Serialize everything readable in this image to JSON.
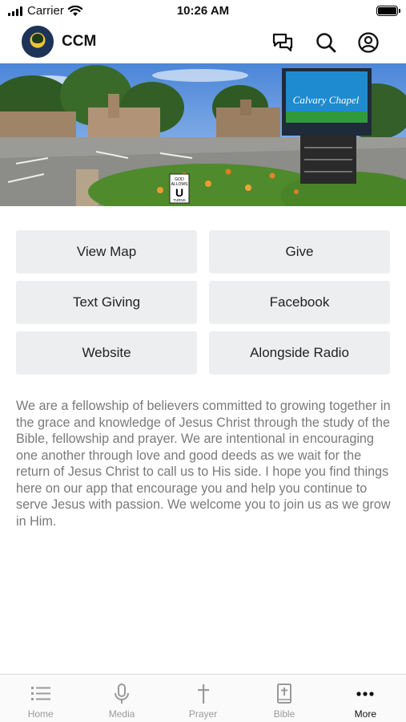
{
  "status_bar": {
    "carrier": "Carrier",
    "time": "10:26 AM"
  },
  "header": {
    "title": "CCM",
    "icons": [
      "chat-icon",
      "search-icon",
      "account-icon"
    ]
  },
  "banner": {
    "sign_title": "Calvary Chapel",
    "sign_small_1": "GOD",
    "sign_small_2": "ALLOWS",
    "sign_small_3": "U",
    "sign_small_4": "TURNS"
  },
  "buttons": [
    "View Map",
    "Give",
    "Text Giving",
    "Facebook",
    "Website",
    "Alongside Radio"
  ],
  "description": "We are a fellowship of believers committed to growing together in the grace and knowledge of Jesus Christ through the study of the Bible, fellowship and prayer. We are intentional in encouraging one another through love and good deeds as we wait for the return of Jesus Christ to call us to His side. I hope you find things here on our app that encourage you and help you continue to serve Jesus with passion.  We welcome you to join us as we grow in Him.",
  "tabs": [
    {
      "label": "Home",
      "icon": "list-icon"
    },
    {
      "label": "Media",
      "icon": "microphone-icon"
    },
    {
      "label": "Prayer",
      "icon": "cross-icon"
    },
    {
      "label": "Bible",
      "icon": "bible-icon"
    },
    {
      "label": "More",
      "icon": "more-icon"
    }
  ],
  "colors": {
    "button_bg": "#edeef0",
    "text_gray": "#7a7a7a",
    "tab_active": "#111111",
    "tab_inactive": "#9a9a9a"
  }
}
